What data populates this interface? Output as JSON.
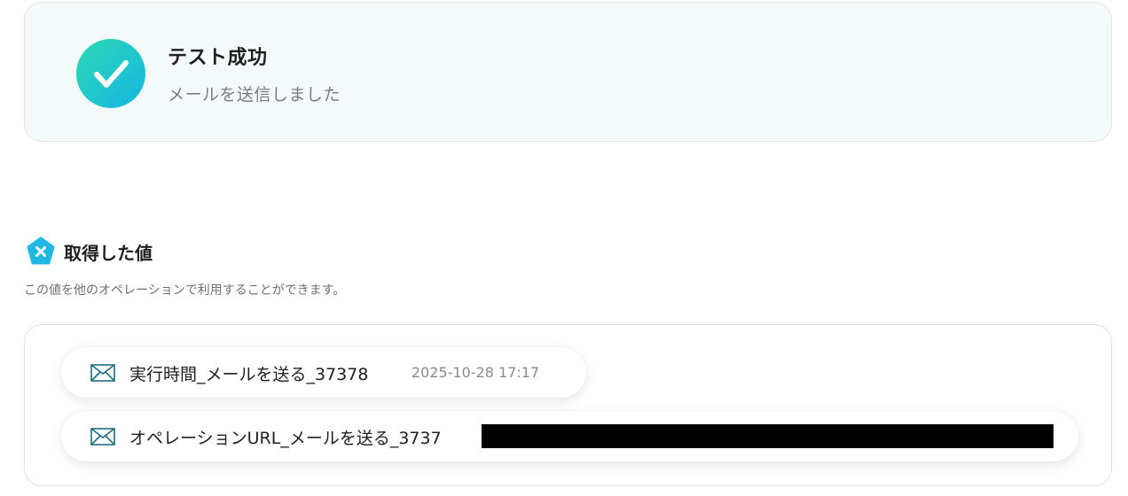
{
  "status": {
    "title": "テスト成功",
    "message": "メールを送信しました"
  },
  "output_section": {
    "title": "取得した値",
    "description": "この値を他のオペレーションで利用することができます。"
  },
  "values": [
    {
      "icon": "mail-icon",
      "label": "実行時間_メールを送る_37378",
      "value": "2025-10-28 17:17"
    },
    {
      "icon": "mail-icon",
      "label": "オペレーションURL_メールを送る_3737",
      "value_redacted": true
    }
  ],
  "colors": {
    "success_gradient_start": "#2ed8b2",
    "success_gradient_end": "#13b7e4",
    "brand_icon": "#1fb8e3"
  }
}
